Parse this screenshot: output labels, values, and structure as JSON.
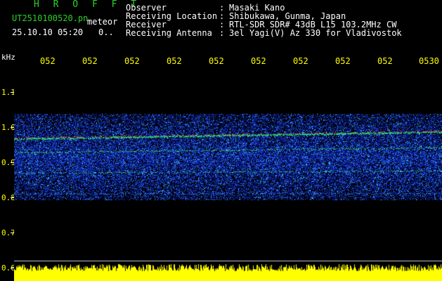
{
  "header": {
    "hroff_title": "H R O F F T",
    "filename": "UT2510100520.pn",
    "filename_suffix": "meteor",
    "datetime": "25.10.10 05:20",
    "counter": "0.."
  },
  "info": [
    {
      "label": "Observer",
      "value": "Masaki Kano"
    },
    {
      "label": "Receiving Location",
      "value": "Shibukawa, Gunma, Japan"
    },
    {
      "label": "Receiver",
      "value": "RTL-SDR SDR# 43dB L15 103.2MHz CW"
    },
    {
      "label": "Receiving Antenna",
      "value": "3el Yagi(V) Az 330 for Vladivostok"
    }
  ],
  "y_axis": {
    "unit": "kHz",
    "ticks": [
      "1.1",
      "1.0",
      "0.9",
      "0.8",
      "0.7",
      "0.6"
    ]
  },
  "x_axis": {
    "ticks": [
      "052",
      "052",
      "052",
      "052",
      "052",
      "052",
      "052",
      "052",
      "052",
      "0530"
    ]
  },
  "colors": {
    "header_green": "#2bd12b",
    "tick_yellow": "#ffff00",
    "background": "#000000",
    "noise_blue": "#1a3fd0",
    "signal_green": "#20e070",
    "signal_red": "#ff2040"
  }
}
